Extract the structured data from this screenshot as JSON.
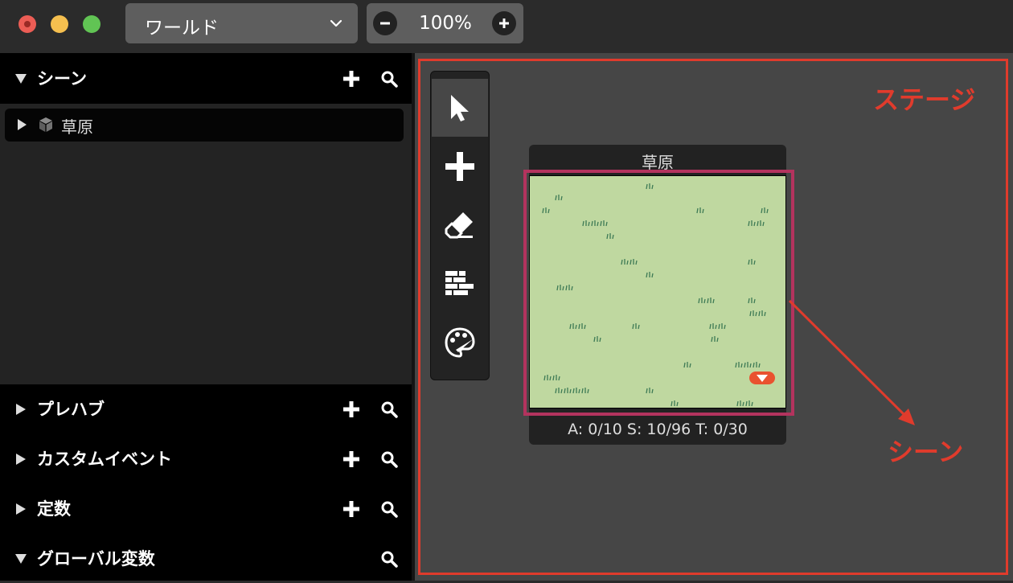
{
  "titlebar": {
    "world_select": "ワールド",
    "zoom_value": "100%"
  },
  "sidebar": {
    "sections": {
      "scene": "シーン",
      "prefab": "プレハブ",
      "custom_event": "カスタムイベント",
      "constants": "定数",
      "global_vars": "グローバル変数"
    },
    "scene_items": [
      {
        "label": "草原"
      }
    ]
  },
  "toolbar": {
    "tools": [
      "select-icon",
      "add-icon",
      "eraser-icon",
      "tile-icon",
      "palette-icon"
    ],
    "active_tool": "select-icon"
  },
  "stage": {
    "label": "ステージ",
    "scene_callout": "シーン",
    "scene_card": {
      "title": "草原",
      "stats": "A: 0/10   S: 10/96   T: 0/30"
    }
  },
  "colors": {
    "annotation": "#e03b2c",
    "scene_highlight": "#b3335e",
    "grass": "#bfd8a0",
    "grass_tuft": "#3d7a55",
    "trigger": "#e9522f"
  }
}
